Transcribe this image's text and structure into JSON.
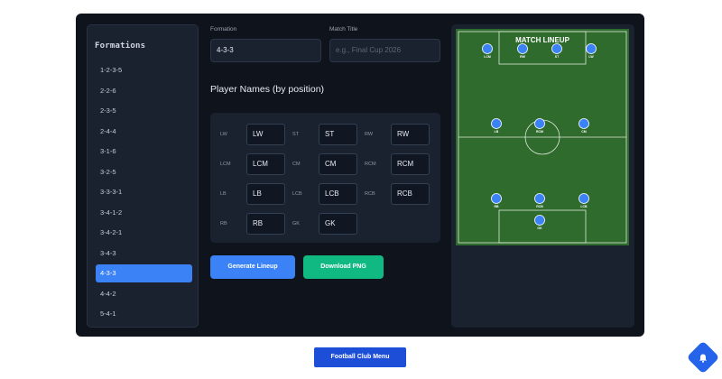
{
  "sidebar": {
    "title": "Formations",
    "items": [
      "1-2-3-5",
      "2-2-6",
      "2-3-5",
      "2-4-4",
      "3-1-6",
      "3-2-5",
      "3-3-3-1",
      "3-4-1-2",
      "3-4-2-1",
      "3-4-3",
      "4-3-3",
      "4-4-2",
      "5-4-1"
    ],
    "active_index": 10
  },
  "form": {
    "formation_label": "Formation",
    "formation_value": "4-3-3",
    "match_title_label": "Match Title",
    "match_title_placeholder": "e.g., Final Cup 2026",
    "players_heading": "Player Names (by position)"
  },
  "positions": [
    {
      "label": "LW",
      "value": "LW"
    },
    {
      "label": "ST",
      "value": "ST"
    },
    {
      "label": "RW",
      "value": "RW"
    },
    {
      "label": "LCM",
      "value": "LCM"
    },
    {
      "label": "CM",
      "value": "CM"
    },
    {
      "label": "RCM",
      "value": "RCM"
    },
    {
      "label": "LB",
      "value": "LB"
    },
    {
      "label": "LCB",
      "value": "LCB"
    },
    {
      "label": "RCB",
      "value": "RCB"
    },
    {
      "label": "RB",
      "value": "RB"
    },
    {
      "label": "GK",
      "value": "GK"
    }
  ],
  "buttons": {
    "generate": "Generate Lineup",
    "download": "Download PNG"
  },
  "preview": {
    "title": "MATCH LINEUP",
    "players": [
      "LCM",
      "RW",
      "ST",
      "LW",
      "LB",
      "RCM",
      "CM",
      "RB",
      "RCB",
      "LCB",
      "GK"
    ]
  },
  "footer": {
    "menu_button": "Football Club Menu"
  },
  "colors": {
    "accent_blue": "#3b82f6",
    "accent_green": "#10b981",
    "pitch": "#2f6b2c",
    "panel": "#1a2230"
  }
}
